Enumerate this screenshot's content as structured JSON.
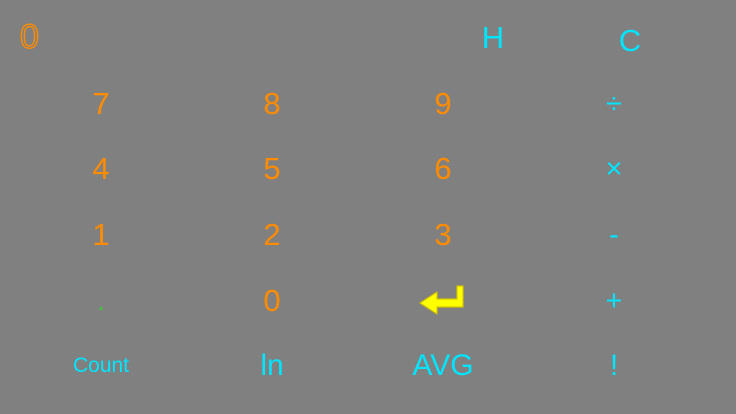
{
  "display": {
    "value": "0"
  },
  "top_keys": [
    {
      "name": "history-button",
      "label": "H"
    },
    {
      "name": "clear-button",
      "label": "C"
    }
  ],
  "keypad": {
    "rows": [
      [
        {
          "name": "key-7",
          "label": "7",
          "kind": "digit"
        },
        {
          "name": "key-8",
          "label": "8",
          "kind": "digit"
        },
        {
          "name": "key-9",
          "label": "9",
          "kind": "digit"
        },
        {
          "name": "divide-button",
          "label": "÷",
          "kind": "op"
        }
      ],
      [
        {
          "name": "key-4",
          "label": "4",
          "kind": "digit"
        },
        {
          "name": "key-5",
          "label": "5",
          "kind": "digit"
        },
        {
          "name": "key-6",
          "label": "6",
          "kind": "digit"
        },
        {
          "name": "multiply-button",
          "label": "×",
          "kind": "op"
        }
      ],
      [
        {
          "name": "key-1",
          "label": "1",
          "kind": "digit"
        },
        {
          "name": "key-2",
          "label": "2",
          "kind": "digit"
        },
        {
          "name": "key-3",
          "label": "3",
          "kind": "digit"
        },
        {
          "name": "subtract-button",
          "label": "-",
          "kind": "op"
        }
      ],
      [
        {
          "name": "decimal-point-button",
          "label": ".",
          "kind": "dot"
        },
        {
          "name": "key-0",
          "label": "0",
          "kind": "digit"
        },
        {
          "name": "enter-button",
          "label": "",
          "kind": "enter",
          "icon": "enter-arrow-icon"
        },
        {
          "name": "add-button",
          "label": "+",
          "kind": "op"
        }
      ],
      [
        {
          "name": "count-button",
          "label": "Count",
          "kind": "fn-sm"
        },
        {
          "name": "ln-button",
          "label": "ln",
          "kind": "fn"
        },
        {
          "name": "average-button",
          "label": "AVG",
          "kind": "fn"
        },
        {
          "name": "factorial-button",
          "label": "!",
          "kind": "fn"
        }
      ]
    ]
  },
  "colors": {
    "background": "#808080",
    "digit": "#ff8c00",
    "operator": "#00e5ff",
    "decimal_point": "#33cc33",
    "enter_icon": "#ffff00",
    "enter_icon_outline": "#d4c400"
  }
}
